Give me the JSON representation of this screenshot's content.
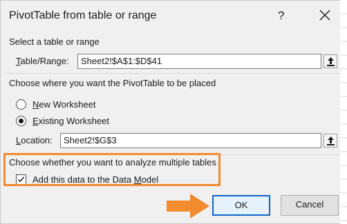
{
  "dialog": {
    "title": "PivotTable from table or range",
    "help_label": "?"
  },
  "section_select": {
    "heading": "Select a table or range",
    "range_label_underlined": "T",
    "range_label_rest": "able/Range:",
    "range_value": "Sheet2!$A$1:$D$41"
  },
  "section_place": {
    "heading": "Choose where you want the PivotTable to be placed",
    "new_ws_underlined": "N",
    "new_ws_rest": "ew Worksheet",
    "new_ws_selected": false,
    "existing_ws_underlined": "E",
    "existing_ws_rest": "xisting Worksheet",
    "existing_ws_selected": true,
    "location_label_underlined": "L",
    "location_label_rest": "ocation:",
    "location_value": "Sheet2!$G$3"
  },
  "section_multiple": {
    "heading": "Choose whether you want to analyze multiple tables",
    "data_model_label_pre": "Add this data to the Data ",
    "data_model_label_underlined": "M",
    "data_model_label_post": "odel",
    "data_model_checked": true
  },
  "buttons": {
    "ok_label": "OK",
    "cancel_label": "Cancel"
  },
  "colors": {
    "highlight": "#f28a2e",
    "ok_border": "#0a64c8",
    "dialog_bg": "#f0f0f0"
  },
  "icons": [
    "collapse-dialog-icon",
    "close-icon",
    "check-icon",
    "pointer-arrow-icon"
  ]
}
